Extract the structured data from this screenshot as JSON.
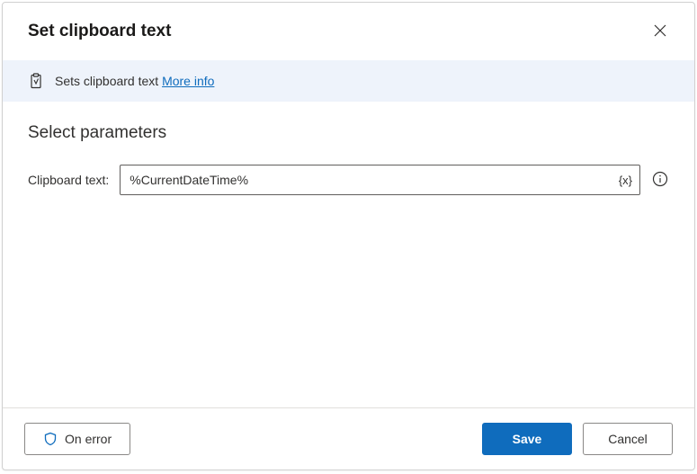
{
  "dialog": {
    "title": "Set clipboard text",
    "banner": {
      "description": "Sets clipboard text ",
      "more_info_label": "More info"
    },
    "section_title": "Select parameters",
    "fields": {
      "clipboard_text": {
        "label": "Clipboard text:",
        "value": "%CurrentDateTime%",
        "var_button": "{x}"
      }
    },
    "footer": {
      "on_error": "On error",
      "save": "Save",
      "cancel": "Cancel"
    }
  }
}
